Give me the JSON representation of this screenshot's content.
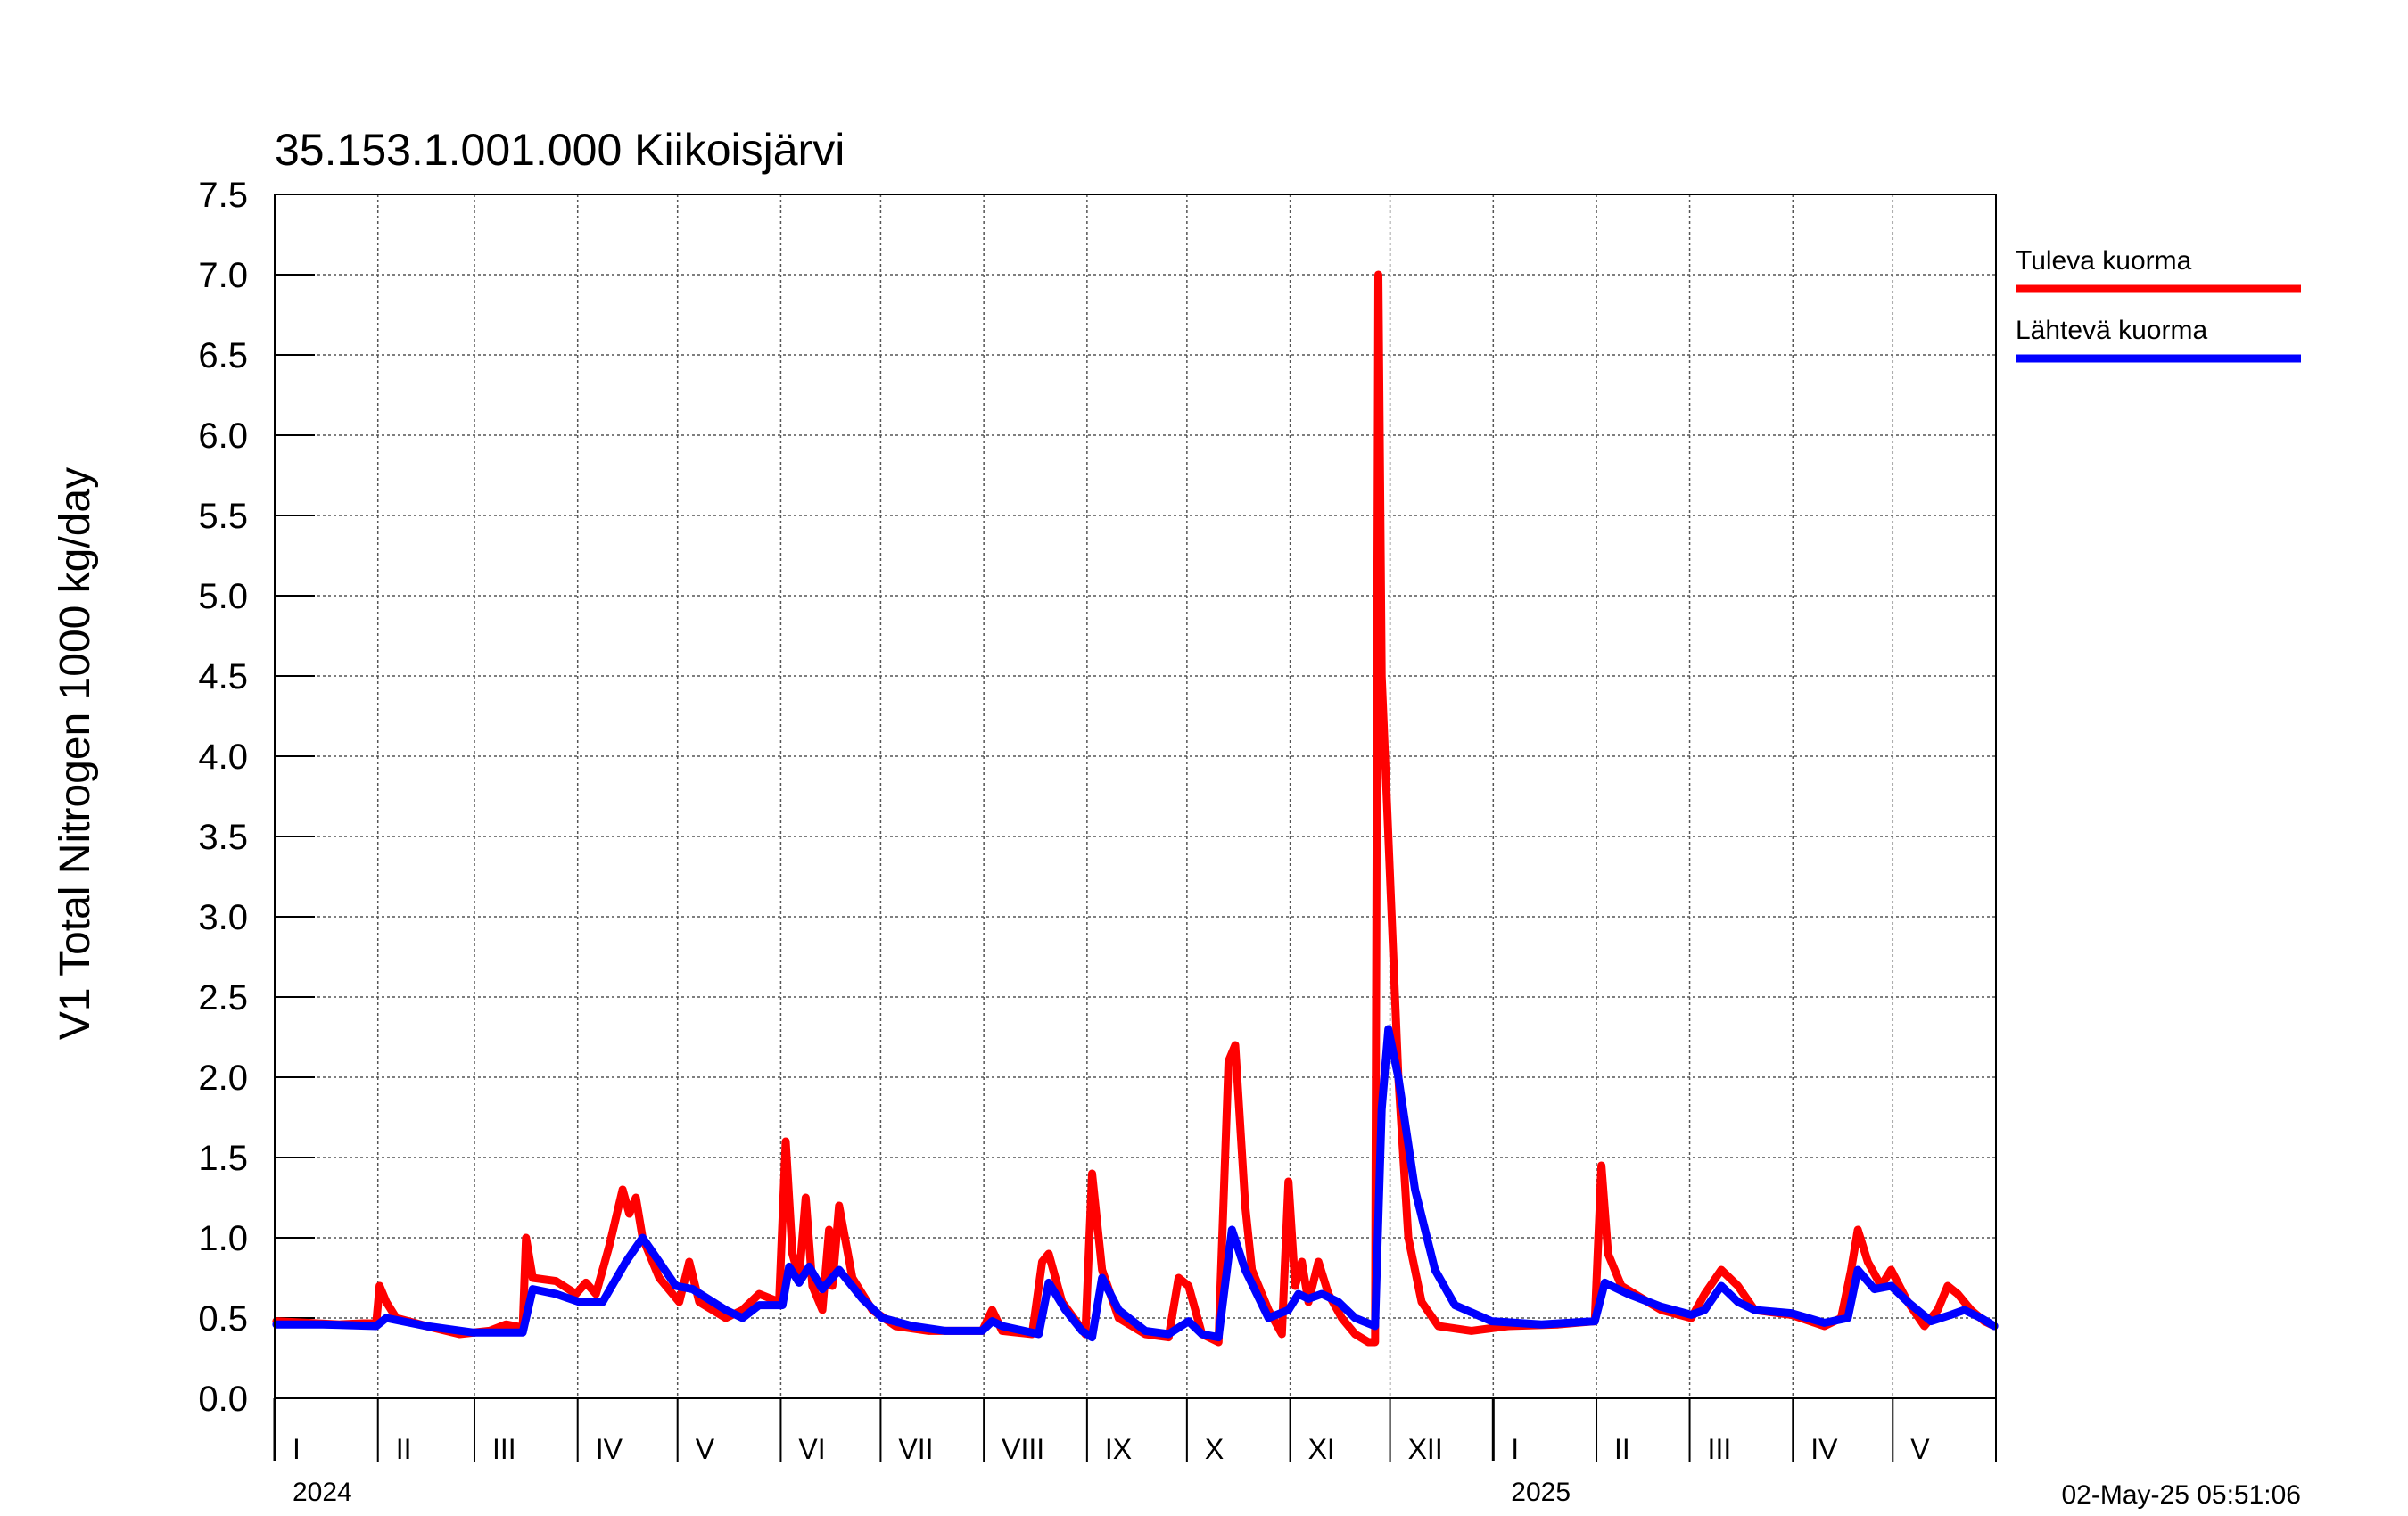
{
  "chart_data": {
    "type": "line",
    "title": "35.153.1.001.000 Kiikoisjärvi",
    "ylabel": "V1 Total Nitrogen 1000 kg/day",
    "ylim": [
      0,
      7.5
    ],
    "yticks": [
      "0.0",
      "0.5",
      "1.0",
      "1.5",
      "2.0",
      "2.5",
      "3.0",
      "3.5",
      "4.0",
      "4.5",
      "5.0",
      "5.5",
      "6.0",
      "6.5",
      "7.0",
      "7.5"
    ],
    "xlim": [
      "2024-01-01",
      "2025-05-31"
    ],
    "month_labels": [
      "I",
      "II",
      "III",
      "IV",
      "V",
      "VI",
      "VII",
      "VIII",
      "IX",
      "X",
      "XI",
      "XII",
      "I",
      "II",
      "III",
      "IV",
      "V"
    ],
    "year_labels": [
      "2024",
      "2025"
    ],
    "grid": true,
    "legend_position": "right",
    "timestamp": "02-May-25 05:51:06",
    "colors": {
      "inflow": "#ff0000",
      "outflow": "#0000ff"
    },
    "series": [
      {
        "name": "Tuleva kuorma",
        "color": "#ff0000",
        "points": [
          [
            "2024-01-01",
            0.48
          ],
          [
            "2024-01-10",
            0.47
          ],
          [
            "2024-01-20",
            0.46
          ],
          [
            "2024-01-31",
            0.47
          ],
          [
            "2024-02-01",
            0.7
          ],
          [
            "2024-02-03",
            0.6
          ],
          [
            "2024-02-06",
            0.5
          ],
          [
            "2024-02-15",
            0.45
          ],
          [
            "2024-02-25",
            0.4
          ],
          [
            "2024-03-05",
            0.42
          ],
          [
            "2024-03-10",
            0.46
          ],
          [
            "2024-03-15",
            0.44
          ],
          [
            "2024-03-16",
            1.0
          ],
          [
            "2024-03-18",
            0.75
          ],
          [
            "2024-03-25",
            0.73
          ],
          [
            "2024-03-31",
            0.65
          ],
          [
            "2024-04-03",
            0.72
          ],
          [
            "2024-04-06",
            0.65
          ],
          [
            "2024-04-10",
            0.95
          ],
          [
            "2024-04-14",
            1.3
          ],
          [
            "2024-04-16",
            1.15
          ],
          [
            "2024-04-18",
            1.25
          ],
          [
            "2024-04-20",
            1.0
          ],
          [
            "2024-04-25",
            0.75
          ],
          [
            "2024-05-01",
            0.6
          ],
          [
            "2024-05-04",
            0.85
          ],
          [
            "2024-05-07",
            0.6
          ],
          [
            "2024-05-15",
            0.5
          ],
          [
            "2024-05-20",
            0.55
          ],
          [
            "2024-05-25",
            0.65
          ],
          [
            "2024-05-31",
            0.6
          ],
          [
            "2024-06-02",
            1.6
          ],
          [
            "2024-06-04",
            0.9
          ],
          [
            "2024-06-06",
            0.75
          ],
          [
            "2024-06-08",
            1.25
          ],
          [
            "2024-06-10",
            0.7
          ],
          [
            "2024-06-13",
            0.55
          ],
          [
            "2024-06-15",
            1.05
          ],
          [
            "2024-06-16",
            0.7
          ],
          [
            "2024-06-18",
            1.2
          ],
          [
            "2024-06-22",
            0.75
          ],
          [
            "2024-06-28",
            0.55
          ],
          [
            "2024-07-05",
            0.45
          ],
          [
            "2024-07-15",
            0.42
          ],
          [
            "2024-07-31",
            0.42
          ],
          [
            "2024-08-03",
            0.55
          ],
          [
            "2024-08-06",
            0.42
          ],
          [
            "2024-08-15",
            0.4
          ],
          [
            "2024-08-18",
            0.85
          ],
          [
            "2024-08-20",
            0.9
          ],
          [
            "2024-08-24",
            0.6
          ],
          [
            "2024-08-31",
            0.4
          ],
          [
            "2024-09-02",
            1.4
          ],
          [
            "2024-09-05",
            0.8
          ],
          [
            "2024-09-10",
            0.5
          ],
          [
            "2024-09-18",
            0.4
          ],
          [
            "2024-09-25",
            0.38
          ],
          [
            "2024-09-28",
            0.75
          ],
          [
            "2024-10-01",
            0.7
          ],
          [
            "2024-10-05",
            0.4
          ],
          [
            "2024-10-10",
            0.35
          ],
          [
            "2024-10-13",
            2.1
          ],
          [
            "2024-10-15",
            2.2
          ],
          [
            "2024-10-18",
            1.2
          ],
          [
            "2024-10-20",
            0.8
          ],
          [
            "2024-10-25",
            0.55
          ],
          [
            "2024-10-29",
            0.4
          ],
          [
            "2024-10-31",
            1.35
          ],
          [
            "2024-11-02",
            0.7
          ],
          [
            "2024-11-04",
            0.85
          ],
          [
            "2024-11-06",
            0.6
          ],
          [
            "2024-11-09",
            0.85
          ],
          [
            "2024-11-12",
            0.65
          ],
          [
            "2024-11-16",
            0.5
          ],
          [
            "2024-11-20",
            0.4
          ],
          [
            "2024-11-24",
            0.35
          ],
          [
            "2024-11-26",
            0.35
          ],
          [
            "2024-11-27",
            7.0
          ],
          [
            "2024-11-28",
            4.5
          ],
          [
            "2024-11-30",
            3.5
          ],
          [
            "2024-12-03",
            2.0
          ],
          [
            "2024-12-06",
            1.0
          ],
          [
            "2024-12-10",
            0.6
          ],
          [
            "2024-12-15",
            0.45
          ],
          [
            "2024-12-25",
            0.42
          ],
          [
            "2025-01-05",
            0.45
          ],
          [
            "2025-01-20",
            0.46
          ],
          [
            "2025-01-31",
            0.48
          ],
          [
            "2025-02-02",
            1.45
          ],
          [
            "2025-02-04",
            0.9
          ],
          [
            "2025-02-08",
            0.7
          ],
          [
            "2025-02-20",
            0.55
          ],
          [
            "2025-03-01",
            0.5
          ],
          [
            "2025-03-05",
            0.65
          ],
          [
            "2025-03-10",
            0.8
          ],
          [
            "2025-03-15",
            0.7
          ],
          [
            "2025-03-20",
            0.55
          ],
          [
            "2025-03-31",
            0.52
          ],
          [
            "2025-04-10",
            0.45
          ],
          [
            "2025-04-15",
            0.5
          ],
          [
            "2025-04-18",
            0.8
          ],
          [
            "2025-04-20",
            1.05
          ],
          [
            "2025-04-23",
            0.85
          ],
          [
            "2025-04-27",
            0.7
          ],
          [
            "2025-04-30",
            0.8
          ],
          [
            "2025-05-05",
            0.6
          ],
          [
            "2025-05-10",
            0.45
          ],
          [
            "2025-05-14",
            0.55
          ],
          [
            "2025-05-17",
            0.7
          ],
          [
            "2025-05-20",
            0.65
          ],
          [
            "2025-05-24",
            0.55
          ],
          [
            "2025-05-28",
            0.48
          ],
          [
            "2025-05-31",
            0.45
          ]
        ]
      },
      {
        "name": "Lähtevä kuorma",
        "color": "#0000ff",
        "points": [
          [
            "2024-01-01",
            0.46
          ],
          [
            "2024-01-15",
            0.46
          ],
          [
            "2024-01-31",
            0.45
          ],
          [
            "2024-02-03",
            0.5
          ],
          [
            "2024-02-15",
            0.45
          ],
          [
            "2024-02-29",
            0.41
          ],
          [
            "2024-03-15",
            0.41
          ],
          [
            "2024-03-18",
            0.68
          ],
          [
            "2024-03-25",
            0.65
          ],
          [
            "2024-04-01",
            0.6
          ],
          [
            "2024-04-08",
            0.6
          ],
          [
            "2024-04-15",
            0.85
          ],
          [
            "2024-04-20",
            1.0
          ],
          [
            "2024-04-25",
            0.85
          ],
          [
            "2024-04-30",
            0.7
          ],
          [
            "2024-05-05",
            0.68
          ],
          [
            "2024-05-15",
            0.55
          ],
          [
            "2024-05-20",
            0.5
          ],
          [
            "2024-05-25",
            0.58
          ],
          [
            "2024-06-01",
            0.58
          ],
          [
            "2024-06-03",
            0.82
          ],
          [
            "2024-06-06",
            0.72
          ],
          [
            "2024-06-09",
            0.82
          ],
          [
            "2024-06-13",
            0.68
          ],
          [
            "2024-06-18",
            0.8
          ],
          [
            "2024-06-25",
            0.62
          ],
          [
            "2024-07-01",
            0.5
          ],
          [
            "2024-07-10",
            0.45
          ],
          [
            "2024-07-20",
            0.42
          ],
          [
            "2024-07-31",
            0.42
          ],
          [
            "2024-08-03",
            0.48
          ],
          [
            "2024-08-06",
            0.45
          ],
          [
            "2024-08-17",
            0.4
          ],
          [
            "2024-08-20",
            0.72
          ],
          [
            "2024-08-25",
            0.55
          ],
          [
            "2024-08-30",
            0.42
          ],
          [
            "2024-09-02",
            0.38
          ],
          [
            "2024-09-05",
            0.75
          ],
          [
            "2024-09-10",
            0.55
          ],
          [
            "2024-09-18",
            0.42
          ],
          [
            "2024-09-25",
            0.4
          ],
          [
            "2024-10-01",
            0.48
          ],
          [
            "2024-10-05",
            0.4
          ],
          [
            "2024-10-10",
            0.38
          ],
          [
            "2024-10-14",
            1.05
          ],
          [
            "2024-10-18",
            0.8
          ],
          [
            "2024-10-25",
            0.5
          ],
          [
            "2024-10-31",
            0.55
          ],
          [
            "2024-11-03",
            0.65
          ],
          [
            "2024-11-06",
            0.62
          ],
          [
            "2024-11-10",
            0.65
          ],
          [
            "2024-11-15",
            0.6
          ],
          [
            "2024-11-20",
            0.5
          ],
          [
            "2024-11-26",
            0.45
          ],
          [
            "2024-11-28",
            1.8
          ],
          [
            "2024-11-30",
            2.3
          ],
          [
            "2024-12-03",
            2.0
          ],
          [
            "2024-12-08",
            1.3
          ],
          [
            "2024-12-14",
            0.8
          ],
          [
            "2024-12-20",
            0.58
          ],
          [
            "2024-12-31",
            0.48
          ],
          [
            "2025-01-15",
            0.46
          ],
          [
            "2025-01-31",
            0.48
          ],
          [
            "2025-02-03",
            0.72
          ],
          [
            "2025-02-10",
            0.65
          ],
          [
            "2025-02-20",
            0.57
          ],
          [
            "2025-03-01",
            0.52
          ],
          [
            "2025-03-05",
            0.55
          ],
          [
            "2025-03-10",
            0.7
          ],
          [
            "2025-03-15",
            0.6
          ],
          [
            "2025-03-20",
            0.55
          ],
          [
            "2025-03-31",
            0.53
          ],
          [
            "2025-04-10",
            0.47
          ],
          [
            "2025-04-17",
            0.5
          ],
          [
            "2025-04-20",
            0.8
          ],
          [
            "2025-04-25",
            0.68
          ],
          [
            "2025-04-30",
            0.7
          ],
          [
            "2025-05-05",
            0.6
          ],
          [
            "2025-05-12",
            0.48
          ],
          [
            "2025-05-18",
            0.52
          ],
          [
            "2025-05-22",
            0.55
          ],
          [
            "2025-05-27",
            0.5
          ],
          [
            "2025-05-31",
            0.45
          ]
        ]
      }
    ]
  }
}
